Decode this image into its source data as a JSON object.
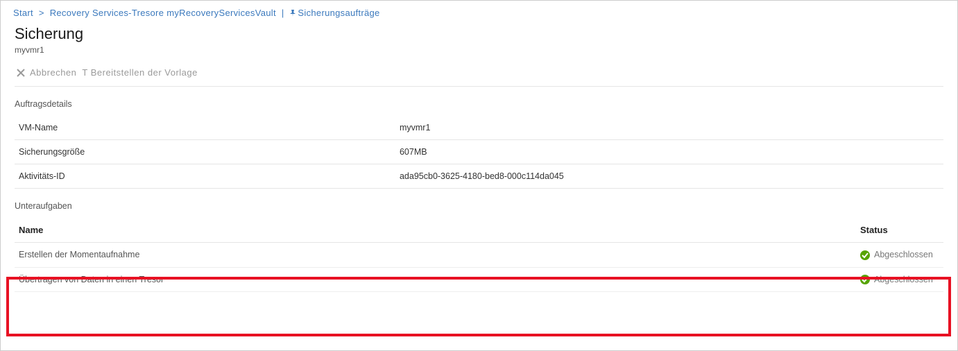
{
  "breadcrumb": {
    "items": [
      {
        "label": "Start"
      },
      {
        "label": "Recovery Services-Tresore"
      },
      {
        "label": "myRecoveryServicesVault"
      },
      {
        "label": "Sicherungsaufträge"
      }
    ],
    "sep": ">",
    "pipe": "|"
  },
  "page": {
    "title": "Sicherung",
    "subtitle": "myvmr1"
  },
  "toolbar": {
    "cancel_label": "Abbrechen",
    "deploy_template_label": "T  Bereitstellen der Vorlage"
  },
  "job_details": {
    "section_title": "Auftragsdetails",
    "rows": [
      {
        "key_label": "VM-Name",
        "value": "myvmr1"
      },
      {
        "key_label": "Sicherungsgröße",
        "value": "607MB"
      },
      {
        "key_label": "Aktivitäts-ID",
        "value": "ada95cb0-3625-4180-bed8-000c114da045"
      }
    ]
  },
  "subtasks": {
    "section_title": "Unteraufgaben",
    "col_name": "Name",
    "col_status": "Status",
    "rows": [
      {
        "name": "Erstellen der Momentaufnahme",
        "status": "Abgeschlossen"
      },
      {
        "name": "Übertragen von Daten in einen Tresor",
        "status": "Abgeschlossen"
      }
    ]
  }
}
